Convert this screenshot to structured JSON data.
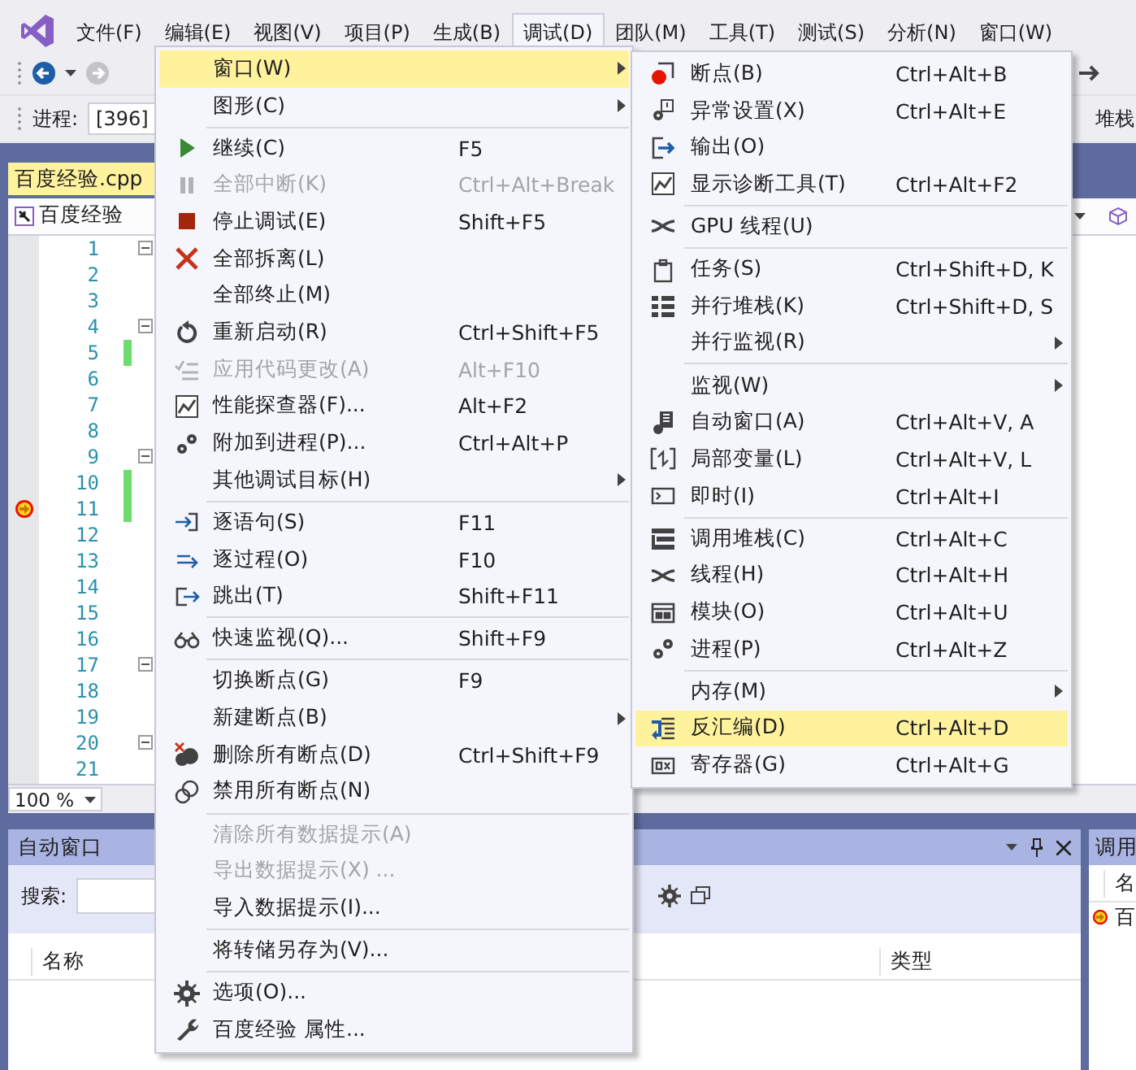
{
  "menubar": [
    {
      "label": "文件(F)",
      "selected": false
    },
    {
      "label": "编辑(E)",
      "selected": false
    },
    {
      "label": "视图(V)",
      "selected": false
    },
    {
      "label": "项目(P)",
      "selected": false
    },
    {
      "label": "生成(B)",
      "selected": false
    },
    {
      "label": "调试(D)",
      "selected": true
    },
    {
      "label": "团队(M)",
      "selected": false
    },
    {
      "label": "工具(T)",
      "selected": false
    },
    {
      "label": "测试(S)",
      "selected": false
    },
    {
      "label": "分析(N)",
      "selected": false
    },
    {
      "label": "窗口(W)",
      "selected": false
    }
  ],
  "toolbar": {
    "process_label": "进程:",
    "process_value": "[396]",
    "stack_label": "堆栈"
  },
  "editor": {
    "tab": "百度经验.cpp",
    "scope": "百度经验",
    "zoom": "100 %",
    "lines": [
      {
        "number": "1",
        "fold": true,
        "changed": false,
        "current": false
      },
      {
        "number": "2",
        "fold": false,
        "changed": false,
        "current": false
      },
      {
        "number": "3",
        "fold": false,
        "changed": false,
        "current": false
      },
      {
        "number": "4",
        "fold": true,
        "changed": false,
        "current": false
      },
      {
        "number": "5",
        "fold": false,
        "changed": true,
        "current": false
      },
      {
        "number": "6",
        "fold": false,
        "changed": false,
        "current": false
      },
      {
        "number": "7",
        "fold": false,
        "changed": false,
        "current": false
      },
      {
        "number": "8",
        "fold": false,
        "changed": false,
        "current": false
      },
      {
        "number": "9",
        "fold": true,
        "changed": false,
        "current": false
      },
      {
        "number": "10",
        "fold": false,
        "changed": true,
        "current": false
      },
      {
        "number": "11",
        "fold": false,
        "changed": true,
        "current": true
      },
      {
        "number": "12",
        "fold": false,
        "changed": false,
        "current": false
      },
      {
        "number": "13",
        "fold": false,
        "changed": false,
        "current": false
      },
      {
        "number": "14",
        "fold": false,
        "changed": false,
        "current": false
      },
      {
        "number": "15",
        "fold": false,
        "changed": false,
        "current": false
      },
      {
        "number": "16",
        "fold": false,
        "changed": false,
        "current": false
      },
      {
        "number": "17",
        "fold": true,
        "changed": false,
        "current": false
      },
      {
        "number": "18",
        "fold": false,
        "changed": false,
        "current": false
      },
      {
        "number": "19",
        "fold": false,
        "changed": false,
        "current": false
      },
      {
        "number": "20",
        "fold": true,
        "changed": false,
        "current": false
      },
      {
        "number": "21",
        "fold": false,
        "changed": false,
        "current": false
      }
    ]
  },
  "autos_panel": {
    "title": "自动窗口",
    "search_label": "搜索:",
    "columns": [
      "名称",
      "类型"
    ]
  },
  "call_stack_panel": {
    "title": "调用",
    "column": "名",
    "rows": [
      {
        "text": "百",
        "current": true
      }
    ]
  },
  "debug_menu": {
    "items": [
      {
        "kind": "item",
        "label": "窗口(W)",
        "submenu": true,
        "disabled": false,
        "selected": true
      },
      {
        "kind": "item",
        "label": "图形(C)",
        "submenu": true,
        "disabled": false,
        "selected": false
      },
      {
        "kind": "separator"
      },
      {
        "kind": "item",
        "label": "继续(C)",
        "shortcut": "F5",
        "submenu": false,
        "disabled": false,
        "selected": false
      },
      {
        "kind": "item",
        "label": "全部中断(K)",
        "shortcut": "Ctrl+Alt+Break",
        "submenu": false,
        "disabled": true,
        "selected": false
      },
      {
        "kind": "item",
        "label": "停止调试(E)",
        "shortcut": "Shift+F5",
        "submenu": false,
        "disabled": false,
        "selected": false
      },
      {
        "kind": "item",
        "label": "全部拆离(L)",
        "submenu": false,
        "disabled": false,
        "selected": false
      },
      {
        "kind": "item",
        "label": "全部终止(M)",
        "submenu": false,
        "disabled": false,
        "selected": false
      },
      {
        "kind": "item",
        "label": "重新启动(R)",
        "shortcut": "Ctrl+Shift+F5",
        "submenu": false,
        "disabled": false,
        "selected": false
      },
      {
        "kind": "item",
        "label": "应用代码更改(A)",
        "shortcut": "Alt+F10",
        "submenu": false,
        "disabled": true,
        "selected": false
      },
      {
        "kind": "item",
        "label": "性能探查器(F)...",
        "shortcut": "Alt+F2",
        "submenu": false,
        "disabled": false,
        "selected": false
      },
      {
        "kind": "item",
        "label": "附加到进程(P)...",
        "shortcut": "Ctrl+Alt+P",
        "submenu": false,
        "disabled": false,
        "selected": false
      },
      {
        "kind": "item",
        "label": "其他调试目标(H)",
        "submenu": true,
        "disabled": false,
        "selected": false
      },
      {
        "kind": "separator"
      },
      {
        "kind": "item",
        "label": "逐语句(S)",
        "shortcut": "F11",
        "submenu": false,
        "disabled": false,
        "selected": false
      },
      {
        "kind": "item",
        "label": "逐过程(O)",
        "shortcut": "F10",
        "submenu": false,
        "disabled": false,
        "selected": false
      },
      {
        "kind": "item",
        "label": "跳出(T)",
        "shortcut": "Shift+F11",
        "submenu": false,
        "disabled": false,
        "selected": false
      },
      {
        "kind": "separator"
      },
      {
        "kind": "item",
        "label": "快速监视(Q)...",
        "shortcut": "Shift+F9",
        "submenu": false,
        "disabled": false,
        "selected": false
      },
      {
        "kind": "separator"
      },
      {
        "kind": "item",
        "label": "切换断点(G)",
        "shortcut": "F9",
        "submenu": false,
        "disabled": false,
        "selected": false
      },
      {
        "kind": "item",
        "label": "新建断点(B)",
        "submenu": true,
        "disabled": false,
        "selected": false
      },
      {
        "kind": "item",
        "label": "删除所有断点(D)",
        "shortcut": "Ctrl+Shift+F9",
        "submenu": false,
        "disabled": false,
        "selected": false
      },
      {
        "kind": "item",
        "label": "禁用所有断点(N)",
        "submenu": false,
        "disabled": false,
        "selected": false
      },
      {
        "kind": "separator"
      },
      {
        "kind": "item",
        "label": "清除所有数据提示(A)",
        "submenu": false,
        "disabled": true,
        "selected": false
      },
      {
        "kind": "item",
        "label": "导出数据提示(X) ...",
        "submenu": false,
        "disabled": true,
        "selected": false
      },
      {
        "kind": "item",
        "label": "导入数据提示(I)...",
        "submenu": false,
        "disabled": false,
        "selected": false
      },
      {
        "kind": "separator"
      },
      {
        "kind": "item",
        "label": "将转储另存为(V)...",
        "submenu": false,
        "disabled": false,
        "selected": false
      },
      {
        "kind": "separator"
      },
      {
        "kind": "item",
        "label": "选项(O)...",
        "submenu": false,
        "disabled": false,
        "selected": false
      },
      {
        "kind": "item",
        "label": "百度经验 属性...",
        "submenu": false,
        "disabled": false,
        "selected": false
      }
    ]
  },
  "window_submenu": {
    "items": [
      {
        "kind": "item",
        "label": "断点(B)",
        "shortcut": "Ctrl+Alt+B",
        "submenu": false,
        "selected": false
      },
      {
        "kind": "item",
        "label": "异常设置(X)",
        "shortcut": "Ctrl+Alt+E",
        "submenu": false,
        "selected": false
      },
      {
        "kind": "item",
        "label": "输出(O)",
        "submenu": false,
        "selected": false
      },
      {
        "kind": "item",
        "label": "显示诊断工具(T)",
        "shortcut": "Ctrl+Alt+F2",
        "submenu": false,
        "selected": false
      },
      {
        "kind": "separator"
      },
      {
        "kind": "item",
        "label": "GPU 线程(U)",
        "submenu": false,
        "selected": false
      },
      {
        "kind": "separator"
      },
      {
        "kind": "item",
        "label": "任务(S)",
        "shortcut": "Ctrl+Shift+D, K",
        "submenu": false,
        "selected": false
      },
      {
        "kind": "item",
        "label": "并行堆栈(K)",
        "shortcut": "Ctrl+Shift+D, S",
        "submenu": false,
        "selected": false
      },
      {
        "kind": "item",
        "label": "并行监视(R)",
        "submenu": true,
        "selected": false
      },
      {
        "kind": "separator"
      },
      {
        "kind": "item",
        "label": "监视(W)",
        "submenu": true,
        "selected": false
      },
      {
        "kind": "item",
        "label": "自动窗口(A)",
        "shortcut": "Ctrl+Alt+V, A",
        "submenu": false,
        "selected": false
      },
      {
        "kind": "item",
        "label": "局部变量(L)",
        "shortcut": "Ctrl+Alt+V, L",
        "submenu": false,
        "selected": false
      },
      {
        "kind": "item",
        "label": "即时(I)",
        "shortcut": "Ctrl+Alt+I",
        "submenu": false,
        "selected": false
      },
      {
        "kind": "separator"
      },
      {
        "kind": "item",
        "label": "调用堆栈(C)",
        "shortcut": "Ctrl+Alt+C",
        "submenu": false,
        "selected": false
      },
      {
        "kind": "item",
        "label": "线程(H)",
        "shortcut": "Ctrl+Alt+H",
        "submenu": false,
        "selected": false
      },
      {
        "kind": "item",
        "label": "模块(O)",
        "shortcut": "Ctrl+Alt+U",
        "submenu": false,
        "selected": false
      },
      {
        "kind": "item",
        "label": "进程(P)",
        "shortcut": "Ctrl+Alt+Z",
        "submenu": false,
        "selected": false
      },
      {
        "kind": "separator"
      },
      {
        "kind": "item",
        "label": "内存(M)",
        "submenu": true,
        "selected": false
      },
      {
        "kind": "item",
        "label": "反汇编(D)",
        "shortcut": "Ctrl+Alt+D",
        "submenu": false,
        "selected": true
      },
      {
        "kind": "item",
        "label": "寄存器(G)",
        "shortcut": "Ctrl+Alt+G",
        "submenu": false,
        "selected": false
      }
    ]
  }
}
